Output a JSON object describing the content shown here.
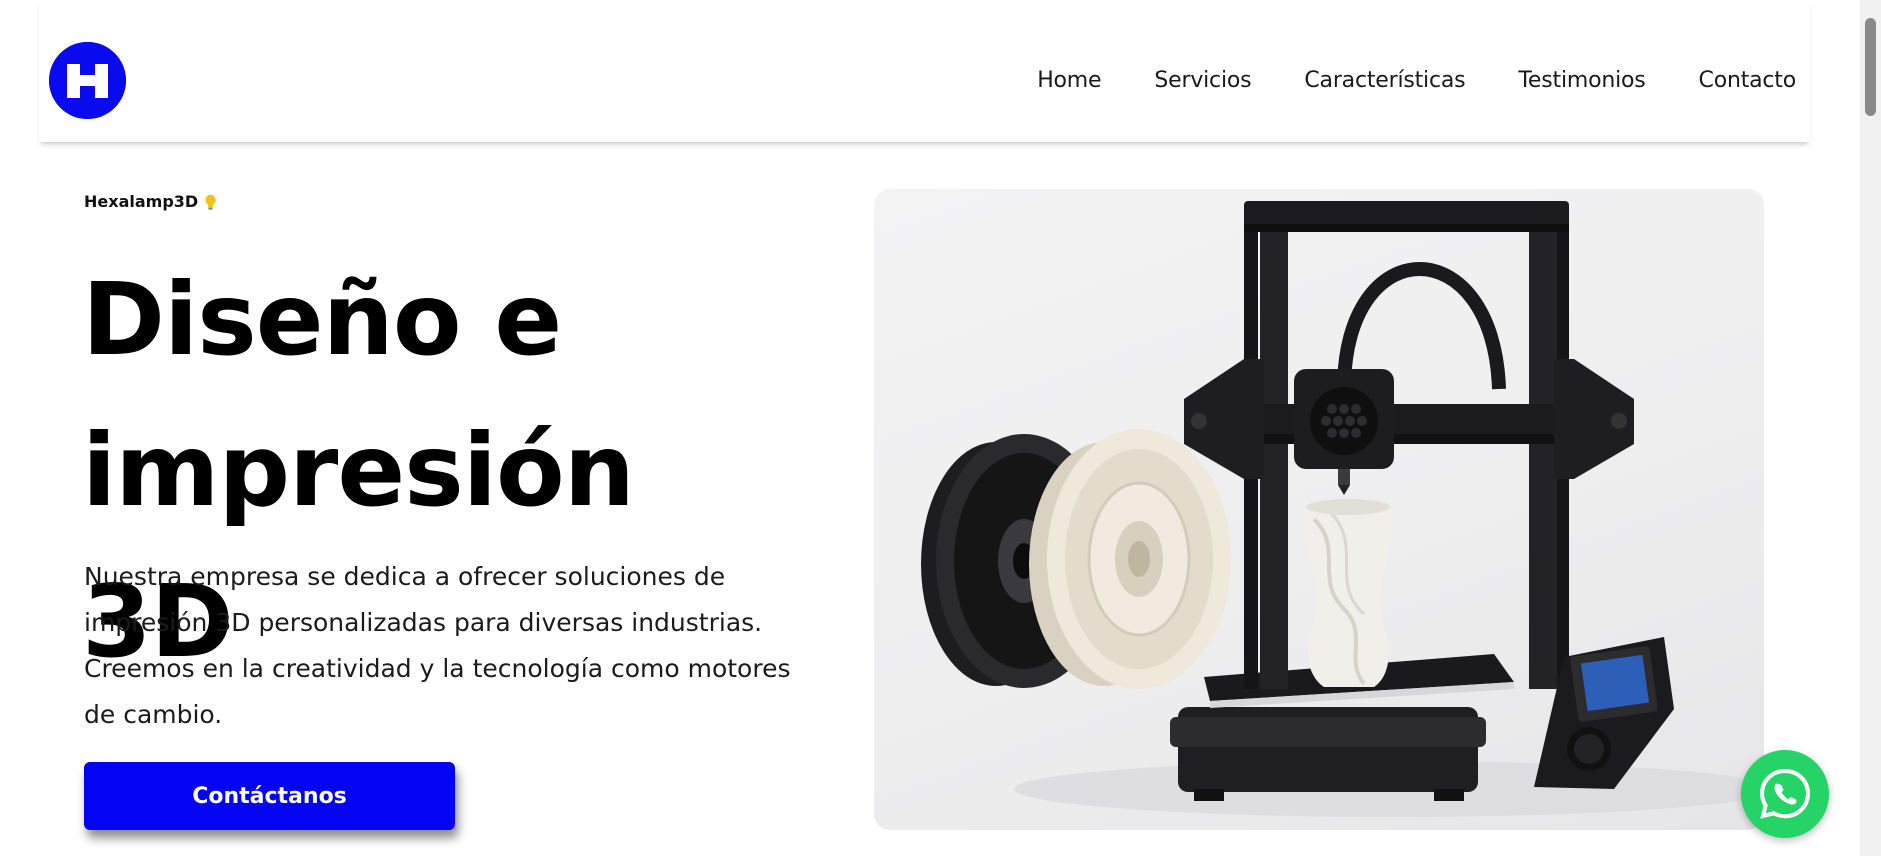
{
  "brand": {
    "logo_letter": "H",
    "logo_color": "#0a0aee"
  },
  "nav": {
    "items": [
      "Home",
      "Servicios",
      "Características",
      "Testimonios",
      "Contacto"
    ]
  },
  "hero": {
    "eyebrow": "Hexalamp3D",
    "eyebrow_icon": "lightbulb-icon",
    "title_line1": "Diseño e",
    "title_line2": "impresión 3D",
    "description": "Nuestra empresa se dedica a ofrecer soluciones de impresión 3D personalizadas para diversas industrias. Creemos en la creatividad y la tecnología como motores de cambio.",
    "cta_label": "Contáctanos",
    "cta_color": "#0404f5",
    "image_icon": "3d-printer-image"
  },
  "whatsapp": {
    "icon": "whatsapp-icon",
    "color": "#25d366"
  }
}
